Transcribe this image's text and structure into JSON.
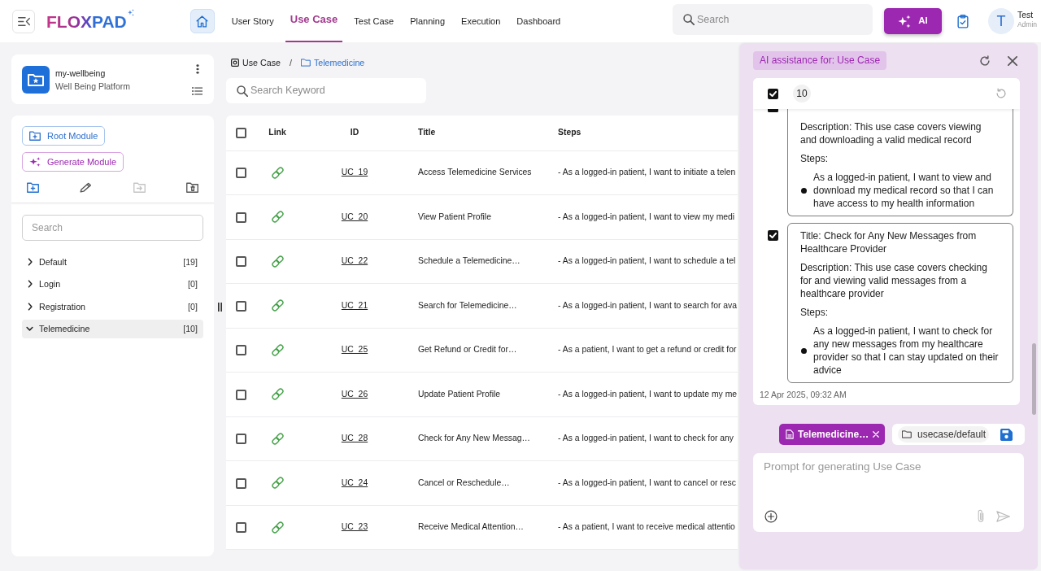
{
  "topbar": {
    "logo": "FLOXPAD",
    "tabs": [
      {
        "label": "User Story",
        "selected": false
      },
      {
        "label": "Use Case",
        "selected": true
      },
      {
        "label": "Test Case",
        "selected": false
      },
      {
        "label": "Planning",
        "selected": false
      },
      {
        "label": "Execution",
        "selected": false
      },
      {
        "label": "Dashboard",
        "selected": false
      }
    ],
    "search": {
      "placeholder": "Search"
    },
    "ai_button": {
      "label": "AI"
    },
    "user": {
      "initial": "T",
      "name": "Test",
      "role": "Admin"
    }
  },
  "project": {
    "name": "my-wellbeing",
    "description": "Well Being Platform"
  },
  "modules": {
    "buttons": [
      {
        "label": "Root Module",
        "kind": "root"
      },
      {
        "label": "Generate Module",
        "kind": "generate"
      }
    ],
    "tools": [
      {
        "kind": "add",
        "disabled": false
      },
      {
        "kind": "edit",
        "disabled": false
      },
      {
        "kind": "move",
        "disabled": true
      },
      {
        "kind": "delete",
        "disabled": false
      }
    ],
    "search": {
      "placeholder": "Search"
    },
    "tree": [
      {
        "label": "Default",
        "count": "[19]",
        "expanded": false,
        "selected": false
      },
      {
        "label": "Login",
        "count": "[0]",
        "expanded": false,
        "selected": false
      },
      {
        "label": "Registration",
        "count": "[0]",
        "expanded": false,
        "selected": false
      },
      {
        "label": "Telemedicine",
        "count": "[10]",
        "expanded": true,
        "selected": true
      }
    ]
  },
  "breadcrumb": {
    "separator": "/",
    "items": [
      {
        "label": "Use Case",
        "kind": "section"
      },
      {
        "label": "Telemedicine",
        "kind": "folder"
      }
    ]
  },
  "keyword_search": {
    "placeholder": "Search Keyword"
  },
  "table": {
    "all_selected": false,
    "columns": [
      "Link",
      "ID",
      "Title",
      "Steps"
    ],
    "rows": [
      {
        "selected": false,
        "id": "UC_19",
        "title": "Access Telemedicine Services",
        "steps": "- As a logged-in patient, I want to initiate a telen"
      },
      {
        "selected": false,
        "id": "UC_20",
        "title": "View Patient Profile",
        "steps": "- As a logged-in patient, I want to view my medi"
      },
      {
        "selected": false,
        "id": "UC_22",
        "title": "Schedule a Telemedicine…",
        "steps": "- As a logged-in patient, I want to schedule a tel"
      },
      {
        "selected": false,
        "id": "UC_21",
        "title": "Search for Telemedicine…",
        "steps": "- As a logged-in patient, I want to search for ava"
      },
      {
        "selected": false,
        "id": "UC_25",
        "title": "Get Refund or Credit for…",
        "steps": "- As a patient, I want to get a refund or credit for"
      },
      {
        "selected": false,
        "id": "UC_26",
        "title": "Update Patient Profile",
        "steps": "- As a logged-in patient, I want to update my me"
      },
      {
        "selected": false,
        "id": "UC_28",
        "title": "Check for Any New Messag…",
        "steps": "- As a logged-in patient, I want to check for any"
      },
      {
        "selected": false,
        "id": "UC_24",
        "title": "Cancel or Reschedule…",
        "steps": "- As a logged-in patient, I want to cancel or resc"
      },
      {
        "selected": false,
        "id": "UC_23",
        "title": "Receive Medical Attention…",
        "steps": "- As a patient, I want to receive medical attentio"
      }
    ]
  },
  "ai_panel": {
    "title": "AI assistance for: Use Case",
    "all_selected": true,
    "count": "10",
    "results": [
      {
        "selected": true,
        "cut_off": true,
        "description": "Description: This use case covers viewing and downloading a valid medical record",
        "steps_label": "Steps:",
        "steps": [
          "As a logged-in patient, I want to view and download my medical record so that I can have access to my health information"
        ]
      },
      {
        "selected": true,
        "cut_off": false,
        "title": "Title: Check for Any New Messages from Healthcare Provider",
        "description": "Description: This use case covers checking for and viewing valid messages from a healthcare provider",
        "steps_label": "Steps:",
        "steps": [
          "As a logged-in patient, I want to check for any new messages from my healthcare provider so that I can stay updated on their advice"
        ]
      }
    ],
    "timestamp": "12 Apr 2025, 09:32 AM",
    "attachment": {
      "label": "Telemedicine…"
    },
    "save_path": "usecase/default",
    "prompt": {
      "placeholder": "Prompt for generating Use Case"
    }
  }
}
